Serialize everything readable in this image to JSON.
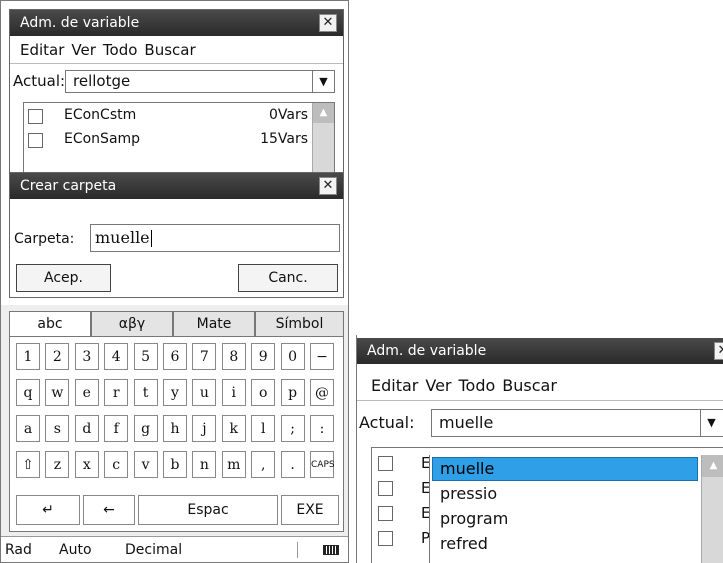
{
  "screen1": {
    "var_manager": {
      "title": "Adm. de variable",
      "close_label": "✕",
      "menu": [
        "Editar",
        "Ver",
        "Todo",
        "Buscar"
      ],
      "actual_label": "Actual:",
      "actual_value": "rellotge",
      "dropdown_icon": "▼",
      "rows": [
        {
          "name": "EConCstm",
          "count": "0Vars"
        },
        {
          "name": "EConSamp",
          "count": "15Vars"
        }
      ],
      "scroll_up_icon": "▲"
    },
    "create_folder": {
      "title": "Crear carpeta",
      "close_label": "✕",
      "field_label": "Carpeta:",
      "field_value": "muelle",
      "accept_label": "Acep.",
      "cancel_label": "Canc."
    },
    "keyboard": {
      "tabs": [
        "abc",
        "αβγ",
        "Mate",
        "Símbol"
      ],
      "active_tab": "abc",
      "rows": [
        [
          "1",
          "2",
          "3",
          "4",
          "5",
          "6",
          "7",
          "8",
          "9",
          "0",
          "−"
        ],
        [
          "q",
          "w",
          "e",
          "r",
          "t",
          "y",
          "u",
          "i",
          "o",
          "p",
          "@"
        ],
        [
          "a",
          "s",
          "d",
          "f",
          "g",
          "h",
          "j",
          "k",
          "l",
          ";",
          ":"
        ],
        [
          "⇧",
          "z",
          "x",
          "c",
          "v",
          "b",
          "n",
          "m",
          ",",
          ".",
          "CAPS"
        ]
      ],
      "enter_icon": "↵",
      "backspace_icon": "←",
      "space_label": "Espac",
      "exe_label": "EXE"
    },
    "statusbar": {
      "angle": "Rad",
      "mode": "Auto",
      "format": "Decimal",
      "battery_icon": "battery-icon"
    }
  },
  "screen2": {
    "title": "Adm. de variable",
    "close_label": "✕",
    "menu": [
      "Editar",
      "Ver",
      "Todo",
      "Buscar"
    ],
    "actual_label": "Actual:",
    "actual_value": "muelle",
    "dropdown_icon": "▼",
    "row_prefixes": [
      "E",
      "E",
      "E",
      "P"
    ],
    "dropdown_options": [
      "muelle",
      "pressio",
      "program",
      "refred"
    ],
    "selected_option": "muelle",
    "scroll_up_icon": "▲"
  },
  "colors": {
    "titlebar": "#333333",
    "highlight": "#2fa0e8",
    "scrollbar": "#d8d8d8"
  }
}
